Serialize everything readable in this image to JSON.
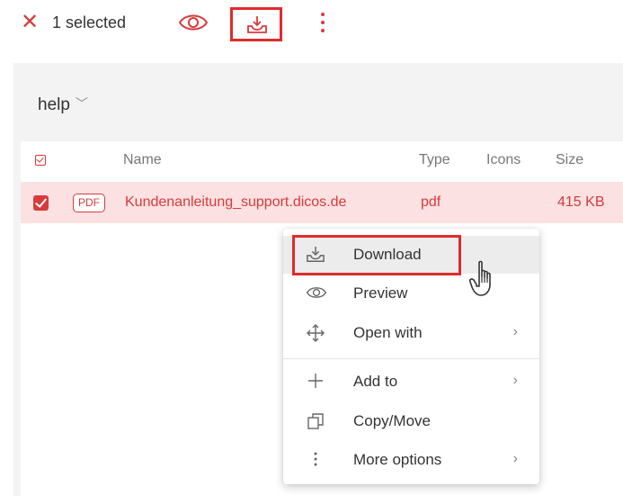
{
  "toolbar": {
    "close_icon": "close-icon",
    "selected_label": "1 selected",
    "preview_icon": "eye-icon",
    "download_icon": "download-icon",
    "more_icon": "more-vertical-icon"
  },
  "folder": {
    "breadcrumb": "help"
  },
  "file_list": {
    "columns": [
      "Name",
      "Type",
      "Icons",
      "Size"
    ],
    "rows": [
      {
        "selected": true,
        "badge": "PDF",
        "name": "Kundenanleitung_support.dicos.de",
        "type": "pdf",
        "icons": "",
        "size": "415 KB"
      }
    ]
  },
  "context_menu": {
    "items": [
      {
        "label": "Download",
        "icon": "download-icon",
        "submenu": false,
        "highlighted": true
      },
      {
        "label": "Preview",
        "icon": "eye-icon",
        "submenu": false
      },
      {
        "label": "Open with",
        "icon": "move-arrows-icon",
        "submenu": true
      },
      {
        "label": "Add to",
        "icon": "plus-icon",
        "submenu": true
      },
      {
        "label": "Copy/Move",
        "icon": "copy-icon",
        "submenu": false
      },
      {
        "label": "More options",
        "icon": "more-vertical-icon",
        "submenu": true
      }
    ]
  },
  "colors": {
    "accent": "#d93a3a",
    "highlight_box": "#e02b2b",
    "selected_row": "#fbe1e1",
    "panel_bg": "#f3f3f3"
  }
}
